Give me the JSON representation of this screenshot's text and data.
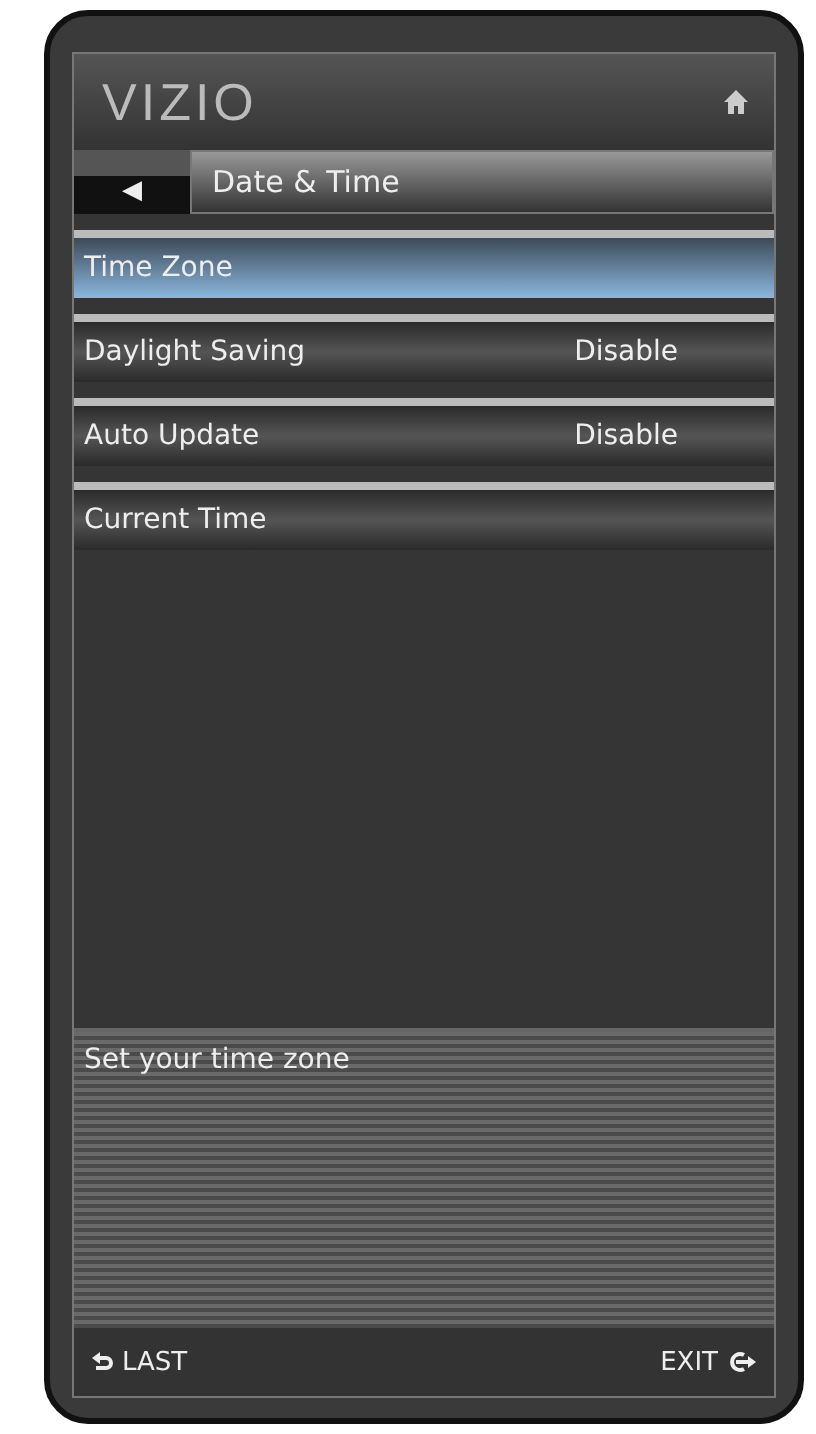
{
  "logo": "VIZIO",
  "title_bar": {
    "back": "◀",
    "title": "Date & Time"
  },
  "menu": [
    {
      "label": "Time Zone",
      "selected": true
    },
    {
      "label": "Daylight Saving",
      "value": "Disable",
      "selected": false
    },
    {
      "label": "Auto Update",
      "value": "Disable",
      "selected": false
    },
    {
      "label": "Current Time",
      "selected": false
    }
  ],
  "help_text": "Set your time zone",
  "footer": {
    "last": "LAST",
    "exit": "EXIT"
  }
}
